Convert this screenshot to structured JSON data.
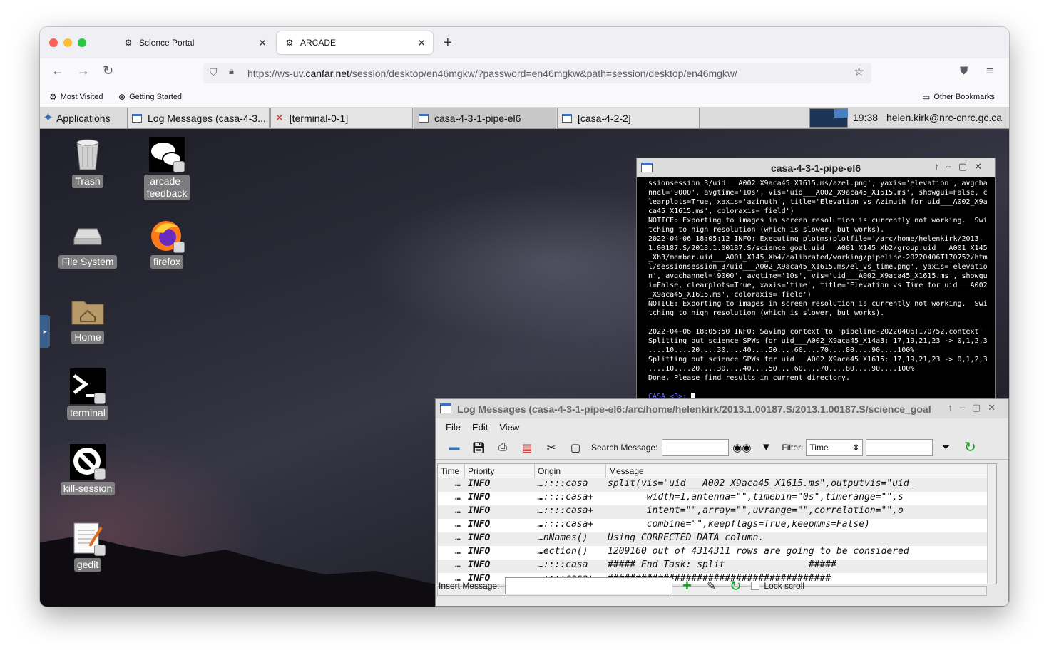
{
  "browser": {
    "tabs": [
      {
        "label": "Science Portal"
      },
      {
        "label": "ARCADE"
      }
    ],
    "url": {
      "prefix": "https://ws-uv.",
      "domain": "canfar.net",
      "path": "/session/desktop/en46mgkw/?password=en46mgkw&path=session/desktop/en46mgkw/"
    },
    "bookmarks": {
      "most_visited": "Most Visited",
      "getting_started": "Getting Started",
      "other": "Other Bookmarks"
    }
  },
  "panel": {
    "applications": "Applications",
    "windows": [
      {
        "label": "Log Messages (casa-4-3..."
      },
      {
        "label": "[terminal-0-1]"
      },
      {
        "label": "casa-4-3-1-pipe-el6"
      },
      {
        "label": "[casa-4-2-2]"
      }
    ],
    "clock": "19:38",
    "user": "helen.kirk@nrc-cnrc.gc.ca"
  },
  "desktop_icons": [
    {
      "label": "Trash"
    },
    {
      "label": "arcade-\nfeedback"
    },
    {
      "label": "File System"
    },
    {
      "label": "firefox"
    },
    {
      "label": "Home"
    },
    {
      "label": "terminal"
    },
    {
      "label": "kill-session"
    },
    {
      "label": "gedit"
    }
  ],
  "terminal": {
    "title": "casa-4-3-1-pipe-el6",
    "output": "ssionsession_3/uid___A002_X9aca45_X1615.ms/azel.png', yaxis='elevation', avgchannel='9000', avgtime='10s', vis='uid___A002_X9aca45_X1615.ms', showgui=False, clearplots=True, xaxis='azimuth', title='Elevation vs Azimuth for uid___A002_X9aca45_X1615.ms', coloraxis='field')\nNOTICE: Exporting to images in screen resolution is currently not working.  Switching to high resolution (which is slower, but works).\n2022-04-06 18:05:12 INFO: Executing plotms(plotfile='/arc/home/helenkirk/2013.1.00187.S/2013.1.00187.S/science_goal.uid___A001_X145_Xb2/group.uid___A001_X145_Xb3/member.uid___A001_X145_Xb4/calibrated/working/pipeline-20220406T170752/html/sessionsession_3/uid___A002_X9aca45_X1615.ms/el_vs_time.png', yaxis='elevation', avgchannel='9000', avgtime='10s', vis='uid___A002_X9aca45_X1615.ms', showgui=False, clearplots=True, xaxis='time', title='Elevation vs Time for uid___A002_X9aca45_X1615.ms', coloraxis='field')\nNOTICE: Exporting to images in screen resolution is currently not working.  Switching to high resolution (which is slower, but works).\n\n2022-04-06 18:05:50 INFO: Saving context to 'pipeline-20220406T170752.context'\nSplitting out science SPWs for uid___A002_X9aca45_X14a3: 17,19,21,23 -> 0,1,2,3\n....10....20....30....40....50....60....70....80....90....100%\nSplitting out science SPWs for uid___A002_X9aca45_X1615: 17,19,21,23 -> 0,1,2,3\n....10....20....30....40....50....60....70....80....90....100%\nDone. Please find results in current directory.\n\n",
    "prompt": "CASA <3>:"
  },
  "logwin": {
    "title": "Log Messages (casa-4-3-1-pipe-el6:/arc/home/helenkirk/2013.1.00187.S/2013.1.00187.S/science_goal",
    "menu": {
      "file": "File",
      "edit": "Edit",
      "view": "View"
    },
    "search_label": "Search Message:",
    "filter_label": "Filter:",
    "filter_value": "Time",
    "columns": [
      "Time",
      "Priority",
      "Origin",
      "Message"
    ],
    "rows": [
      {
        "time": "…",
        "priority": "INFO",
        "origin": "…::::casa",
        "message": "split(vis=\"uid___A002_X9aca45_X1615.ms\",outputvis=\"uid_"
      },
      {
        "time": "…",
        "priority": "INFO",
        "origin": "…::::casa+",
        "message": "       width=1,antenna=\"\",timebin=\"0s\",timerange=\"\",s"
      },
      {
        "time": "…",
        "priority": "INFO",
        "origin": "…::::casa+",
        "message": "       intent=\"\",array=\"\",uvrange=\"\",correlation=\"\",o"
      },
      {
        "time": "…",
        "priority": "INFO",
        "origin": "…::::casa+",
        "message": "       combine=\"\",keepflags=True,keepmms=False)"
      },
      {
        "time": "…",
        "priority": "INFO",
        "origin": "…nNames()",
        "message": "Using CORRECTED_DATA column."
      },
      {
        "time": "…",
        "priority": "INFO",
        "origin": "…ection()",
        "message": "1209160 out of 4314311 rows are going to be considered"
      },
      {
        "time": "…",
        "priority": "INFO",
        "origin": "…::::casa",
        "message": "##### End Task: split               #####"
      },
      {
        "time": "…",
        "priority": "INFO",
        "origin": "…::::casa+",
        "message": "########################################"
      }
    ],
    "insert_label": "Insert Message:",
    "lock_scroll": "Lock scroll"
  }
}
